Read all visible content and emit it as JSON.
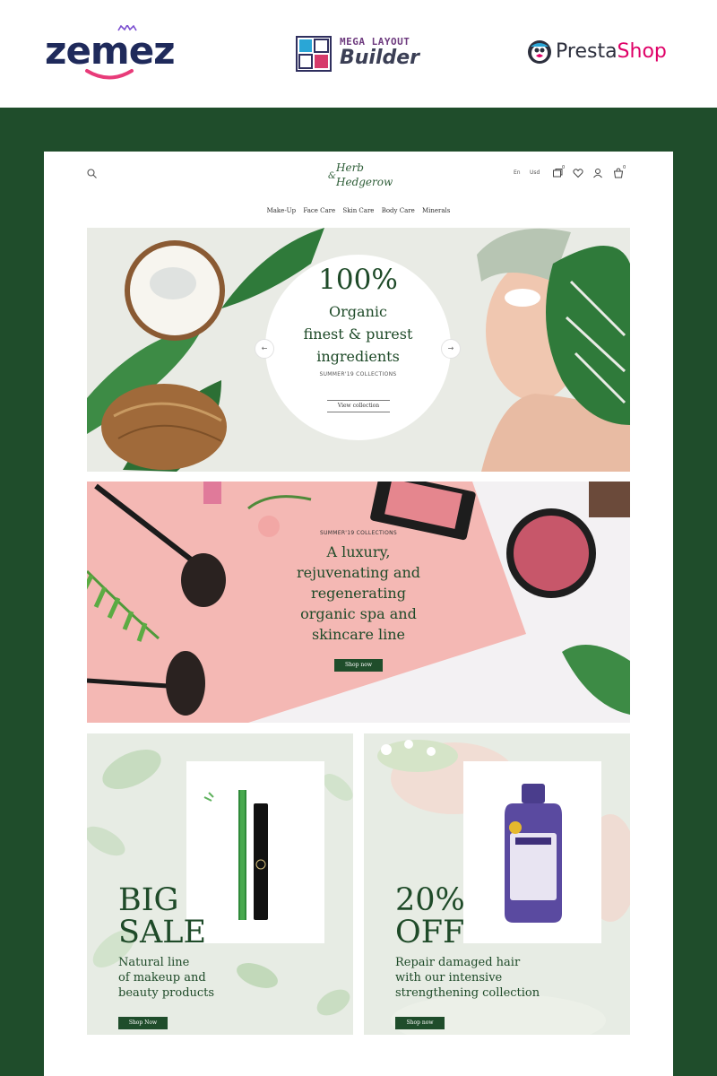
{
  "brands": {
    "zemes": "zemez",
    "mlb_top": "MEGA LAYOUT",
    "mlb_bottom": "Builder",
    "presta_a": "Presta",
    "presta_b": "Shop"
  },
  "colors": {
    "backdrop": "#1f4d2b",
    "primary_green": "#1e4a28",
    "presta_pink": "#df0067",
    "zemez_navy": "#1f2a5b"
  },
  "header": {
    "logo_line1": "Herb",
    "logo_amp": "&",
    "logo_line2": "Hedgerow",
    "language": "En",
    "currency": "Usd",
    "compare_count": "0",
    "cart_count": "0",
    "icons": [
      "search-icon",
      "compare-icon",
      "heart-icon",
      "user-icon",
      "cart-icon"
    ]
  },
  "nav": {
    "items": [
      "Make-Up",
      "Face Care",
      "Skin Care",
      "Body Care",
      "Minerals"
    ]
  },
  "hero": {
    "percent": "100%",
    "line1": "Organic",
    "line2": "finest & purest",
    "line3": "ingredients",
    "subtitle": "SUMMER'19 COLLECTIONS",
    "cta": "View collection",
    "prev": "←",
    "next": "→"
  },
  "banner2": {
    "subtitle": "SUMMER'19 COLLECTIONS",
    "line1": "A luxury,",
    "line2": "rejuvenating and",
    "line3": "regenerating",
    "line4": "organic spa and",
    "line5": "skincare line",
    "cta": "Shop now"
  },
  "promo_left": {
    "big1": "BIG",
    "big2": "SALE",
    "text1": "Natural line",
    "text2": "of makeup and",
    "text3": "beauty products",
    "cta": "Shop Now"
  },
  "promo_right": {
    "big1": "20%",
    "big2": "OFF",
    "text1": "Repair damaged hair",
    "text2": "with our intensive",
    "text3": "strengthening collection",
    "cta": "Shop now"
  }
}
